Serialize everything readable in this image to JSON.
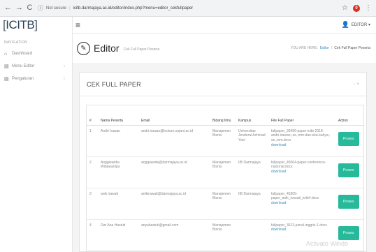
{
  "browser": {
    "back": "←",
    "forward": "→",
    "reload": "C",
    "security_icon": "ⓘ",
    "security_label": "Not secure",
    "separator": "|",
    "url": "icitb.darmajaya.ac.id/editor/index.php?menu=editor_cekfullpaper",
    "profile_initial": "0"
  },
  "sidebar": {
    "brand": "ICITB",
    "heading": "NAVIGATION",
    "items": [
      {
        "label": "Dashboard",
        "icon": "home-icon"
      },
      {
        "label": "Menu Editor",
        "icon": "file-icon"
      },
      {
        "label": "Pengaturan",
        "icon": "file-icon"
      }
    ]
  },
  "topbar": {
    "user_label": "EDITOR ▾"
  },
  "page": {
    "title": "Editor",
    "subtitle": "Cek Full Paper Peserta",
    "crumb_here": "YOU ARE HERE:",
    "crumb_link": "Editor",
    "crumb_sep": "/",
    "crumb_current": "Cek Full Paper Peserta"
  },
  "panel": {
    "title": "CEK FULL PAPER",
    "tools": "− ×"
  },
  "table": {
    "headers": {
      "no": "#",
      "nama": "Nama Peserta",
      "email": "Email",
      "bidang": "Bidang Ilmu",
      "kampus": "Kampus",
      "file": "File Full Paper",
      "action": "Action"
    },
    "rows": [
      {
        "no": "1",
        "nama": "Andri Irawan",
        "email": "andri.irawan@lecture.unjani.ac.id",
        "bidang": "Manajemen Bisnis",
        "kampus": "Universitas Jenderal Achmad Yani",
        "file": "fullpaper_39496-paper-icitb-2018-andri-irawan;-se.,mm-dan-eka-kahya;-se.,mm.docx",
        "download": "download",
        "action": "Proses"
      },
      {
        "no": "2",
        "nama": "Anggiawidia Wibawanipa",
        "email": "anggiawida@darmajaya.ac.id",
        "bidang": "Manajemen Bisnis",
        "kampus": "IIB Darmajaya",
        "file": "fullpaper_45064-paper-conference-nasional.docx",
        "download": "download",
        "action": "Proses"
      },
      {
        "no": "3",
        "nama": "anik irawati",
        "email": "anikirawati@darmajaya.ac.id",
        "bidang": "Manajemen Bisnis",
        "kampus": "IIB Darmajaya",
        "file": "fullpaper_45305-paper_anik_irawati_icitb4.docx",
        "download": "download",
        "action": "Proses"
      },
      {
        "no": "4",
        "nama": "Dwi Ana Hastuti",
        "email": "anyahastuti@gmail.com",
        "bidang": "Manajemen Bisnis",
        "kampus": "",
        "file": "fullpaper_3613-jurnal-inggris-1.docx",
        "download": "download",
        "action": "Proses"
      }
    ]
  },
  "watermark": "Activate Windo"
}
